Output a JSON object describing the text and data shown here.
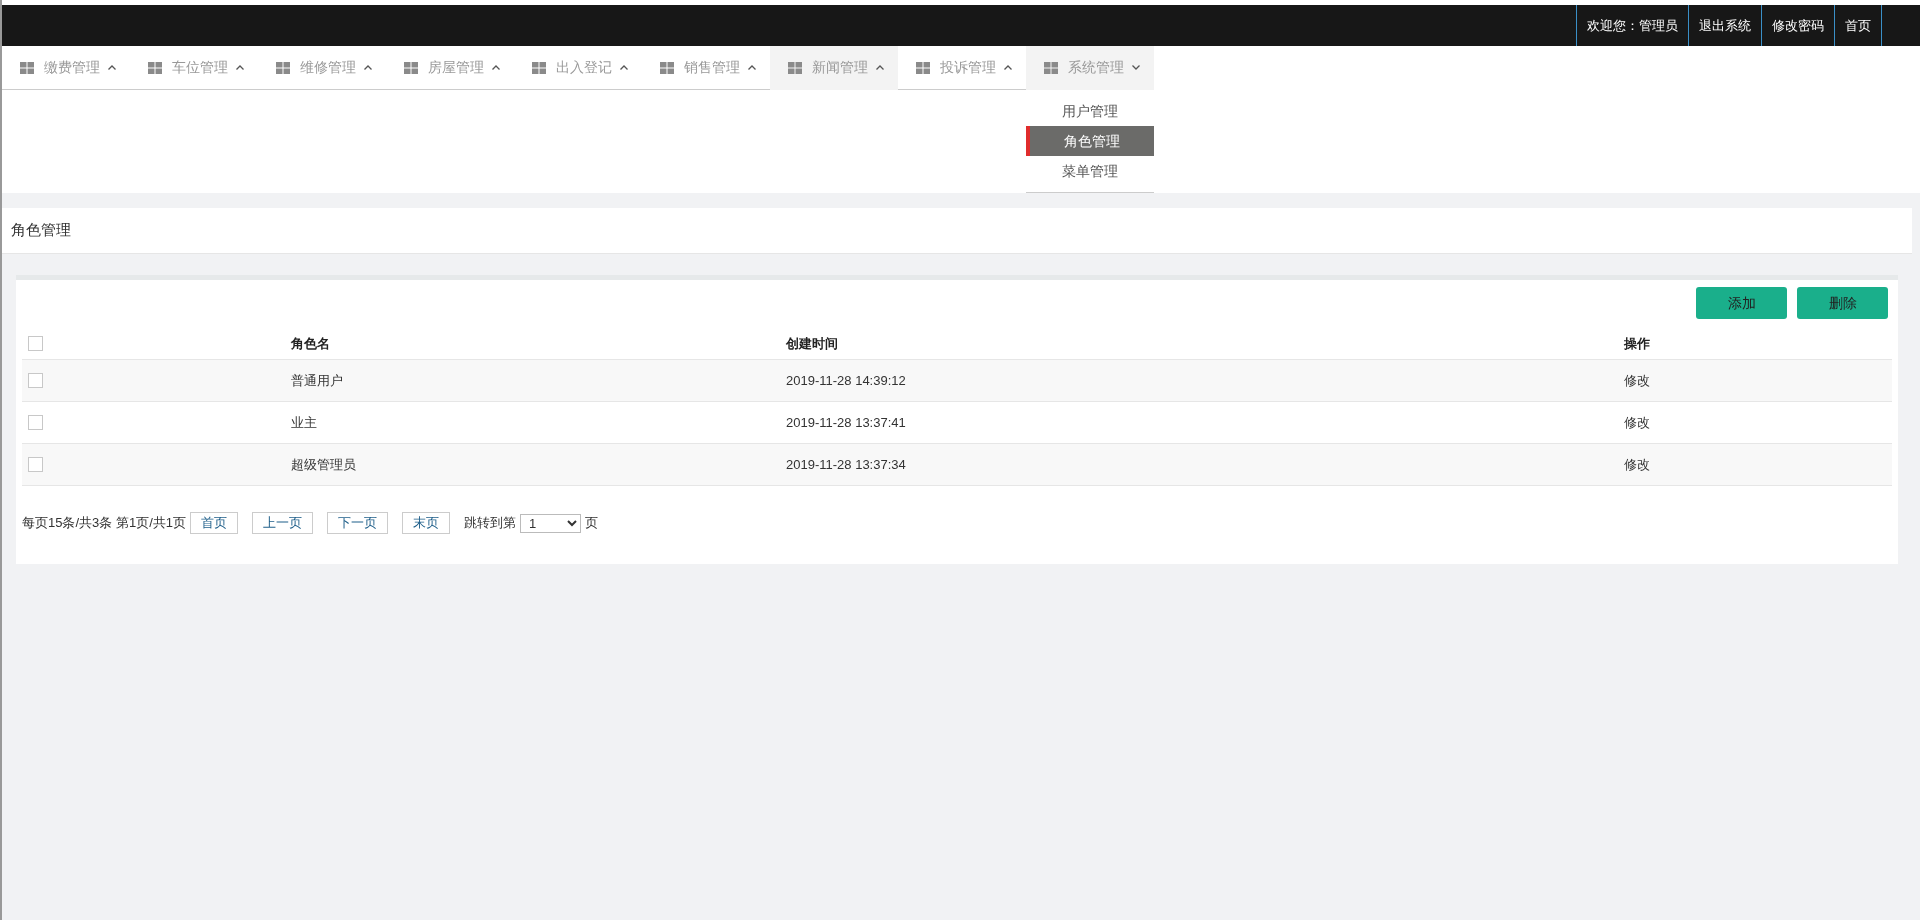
{
  "top_bar": {
    "links": [
      {
        "label": "欢迎您：管理员"
      },
      {
        "label": "退出系统"
      },
      {
        "label": "修改密码"
      },
      {
        "label": "首页"
      }
    ]
  },
  "nav": {
    "items": [
      {
        "label": "缴费管理",
        "highlighted": false,
        "expanded": false
      },
      {
        "label": "车位管理",
        "highlighted": false,
        "expanded": false
      },
      {
        "label": "维修管理",
        "highlighted": false,
        "expanded": false
      },
      {
        "label": "房屋管理",
        "highlighted": false,
        "expanded": false
      },
      {
        "label": "出入登记",
        "highlighted": false,
        "expanded": false
      },
      {
        "label": "销售管理",
        "highlighted": false,
        "expanded": false
      },
      {
        "label": "新闻管理",
        "highlighted": true,
        "expanded": false
      },
      {
        "label": "投诉管理",
        "highlighted": false,
        "expanded": false
      },
      {
        "label": "系统管理",
        "highlighted": true,
        "expanded": true,
        "children": [
          {
            "label": "用户管理",
            "selected": false
          },
          {
            "label": "角色管理",
            "selected": true
          },
          {
            "label": "菜单管理",
            "selected": false
          }
        ]
      }
    ]
  },
  "page_title": "角色管理",
  "toolbar": {
    "buttons": [
      "添加",
      "删除"
    ]
  },
  "table": {
    "columns": [
      "角色名",
      "创建时间",
      "操作"
    ],
    "header_checked": false,
    "rows": [
      {
        "checked": false,
        "cells": [
          "普通用户",
          "2019-11-28 14:39:12",
          "修改"
        ]
      },
      {
        "checked": false,
        "cells": [
          "业主",
          "2019-11-28 13:37:41",
          "修改"
        ]
      },
      {
        "checked": false,
        "cells": [
          "超级管理员",
          "2019-11-28 13:37:34",
          "修改"
        ]
      }
    ]
  },
  "pagination": {
    "summary": "每页15条/共3条 第1页/共1页",
    "buttons": [
      "首页",
      "上一页",
      "下一页",
      "末页"
    ],
    "jump_label": "跳转到第",
    "jump_value": "1",
    "jump_suffix": "页"
  }
}
